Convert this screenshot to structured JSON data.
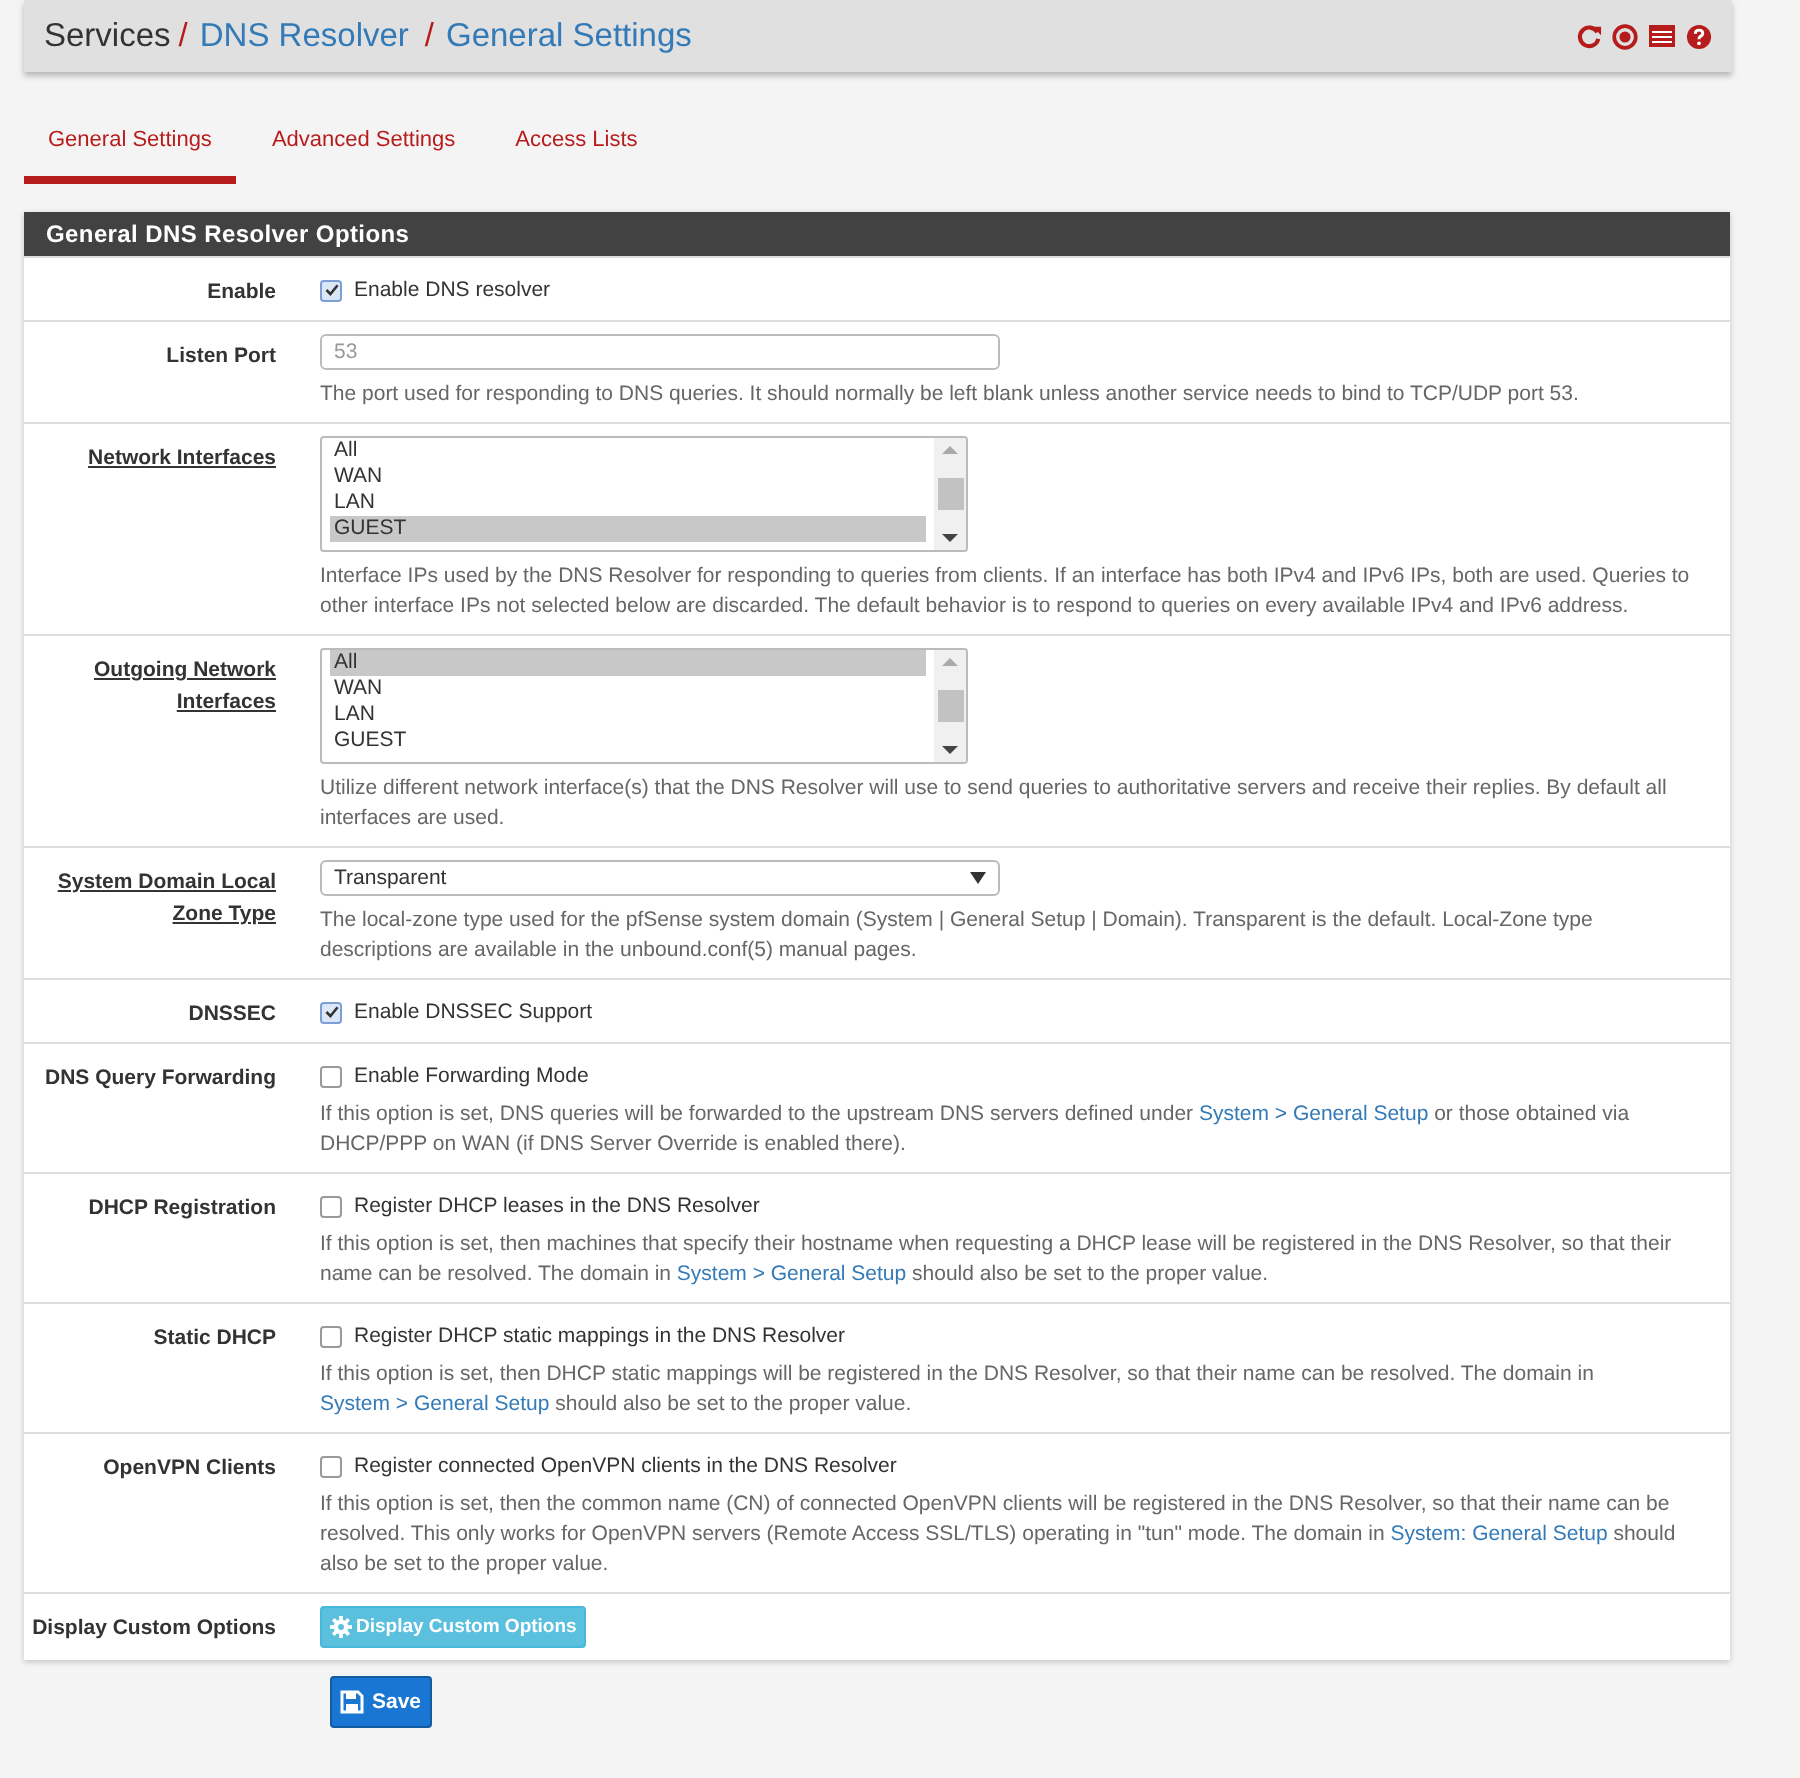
{
  "breadcrumb": [
    "Services",
    "DNS Resolver",
    "General Settings"
  ],
  "breadcrumb_separator": "/",
  "tabs": [
    {
      "label": "General Settings",
      "selected": true
    },
    {
      "label": "Advanced Settings",
      "selected": false
    },
    {
      "label": "Access Lists",
      "selected": false
    }
  ],
  "panel": {
    "title": "General DNS Resolver Options",
    "rows": [
      {
        "kind": "checkbox",
        "label": "Enable",
        "label_link": false,
        "checkbox_label": "Enable DNS resolver",
        "checked": true
      },
      {
        "kind": "text",
        "label": "Listen Port",
        "label_link": false,
        "placeholder": "53",
        "help": [
          "The port used for responding to DNS queries. It should normally be left blank unless another service needs to bind to TCP/UDP port 53."
        ]
      },
      {
        "kind": "listbox",
        "label": "Network Interfaces",
        "label_link": true,
        "options": [
          {
            "label": "All",
            "selected": false
          },
          {
            "label": "WAN",
            "selected": false
          },
          {
            "label": "LAN",
            "selected": false
          },
          {
            "label": "GUEST",
            "selected": true
          }
        ],
        "help": [
          "Interface IPs used by the DNS Resolver for responding to queries from clients. If an interface has both IPv4 and IPv6 IPs, both are used. Queries to other interface IPs not selected below are discarded. The default behavior is to respond to queries on every available IPv4 and IPv6 address."
        ]
      },
      {
        "kind": "listbox",
        "label": "Outgoing Network Interfaces",
        "label_link": true,
        "options": [
          {
            "label": "All",
            "selected": true
          },
          {
            "label": "WAN",
            "selected": false
          },
          {
            "label": "LAN",
            "selected": false
          },
          {
            "label": "GUEST",
            "selected": false
          }
        ],
        "help": [
          "Utilize different network interface(s) that the DNS Resolver will use to send queries to authoritative servers and receive their replies. By default all interfaces are used."
        ]
      },
      {
        "kind": "select",
        "label": "System Domain Local Zone Type",
        "label_link": true,
        "value": "Transparent",
        "help": [
          "The local-zone type used for the pfSense system domain (System | General Setup | Domain). Transparent is the default. Local-Zone type descriptions are available in the unbound.conf(5) manual pages."
        ]
      },
      {
        "kind": "checkbox",
        "label": "DNSSEC",
        "label_link": false,
        "checkbox_label": "Enable DNSSEC Support",
        "checked": true
      },
      {
        "kind": "checkbox",
        "label": "DNS Query Forwarding",
        "label_link": false,
        "checkbox_label": "Enable Forwarding Mode",
        "checked": false,
        "help": [
          "If this option is set, DNS queries will be forwarded to the upstream DNS servers defined under "
        ],
        "help_link": "System > General Setup",
        "help_after": " or those obtained via DHCP/PPP on WAN (if DNS Server Override is enabled there)."
      },
      {
        "kind": "checkbox",
        "label": "DHCP Registration",
        "label_link": false,
        "checkbox_label": "Register DHCP leases in the DNS Resolver",
        "checked": false,
        "help": [
          "If this option is set, then machines that specify their hostname when requesting a DHCP lease will be registered in the DNS Resolver, so that their name can be resolved. The domain in "
        ],
        "help_link": "System > General Setup",
        "help_after": " should also be set to the proper value."
      },
      {
        "kind": "checkbox",
        "label": "Static DHCP",
        "label_link": false,
        "checkbox_label": "Register DHCP static mappings in the DNS Resolver",
        "checked": false,
        "help": [
          "If this option is set, then DHCP static mappings will be registered in the DNS Resolver, so that their name can be resolved. The domain in "
        ],
        "help_link": "System > General Setup",
        "help_after": " should also be set to the proper value."
      },
      {
        "kind": "checkbox",
        "label": "OpenVPN Clients",
        "label_link": false,
        "checkbox_label": "Register connected OpenVPN clients in the DNS Resolver",
        "checked": false,
        "help": [
          "If this option is set, then the common name (CN) of connected OpenVPN clients will be registered in the DNS Resolver, so that their name can be resolved. This only works for OpenVPN servers (Remote Access SSL/TLS) operating in \"tun\" mode. The domain in "
        ],
        "help_link": "System: General Setup",
        "help_after": " should also be set to the proper value."
      },
      {
        "kind": "button",
        "label": "Display Custom Options",
        "label_link": false,
        "button_label": "Display Custom Options"
      }
    ]
  },
  "save_button": "Save"
}
